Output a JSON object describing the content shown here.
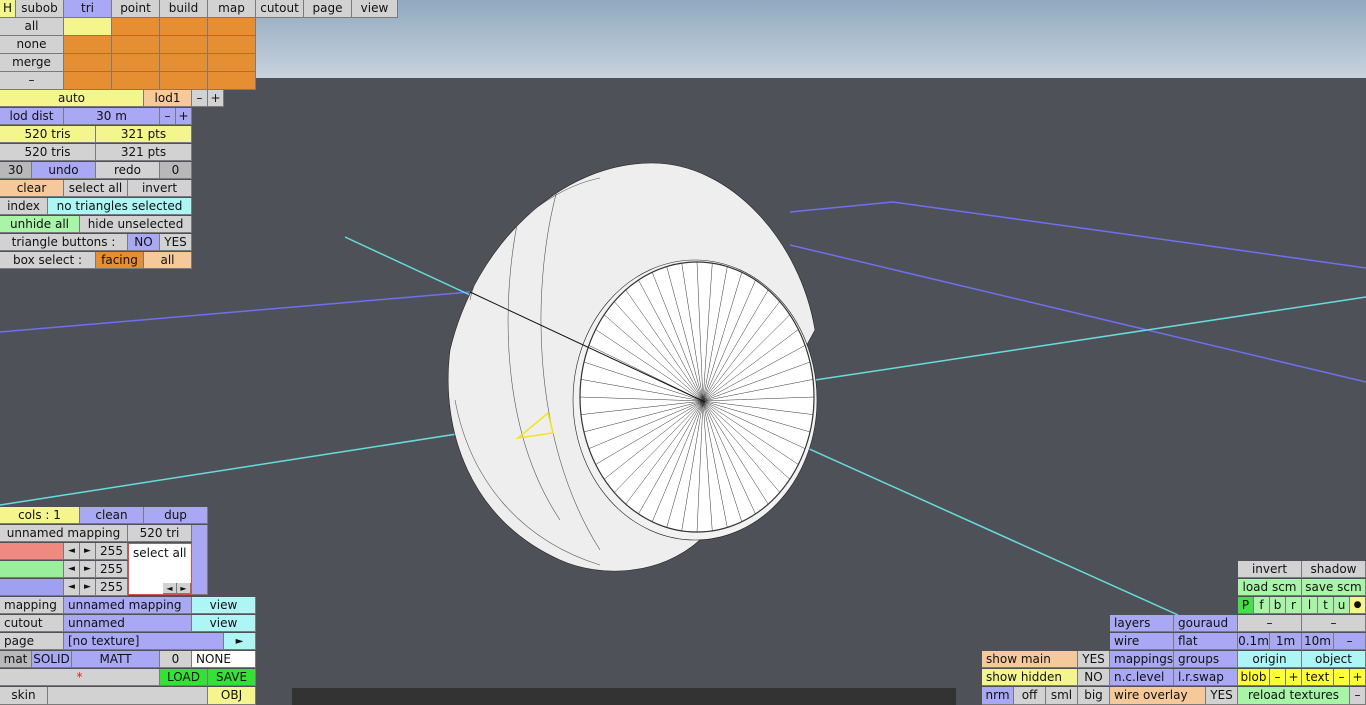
{
  "top_tabs": [
    "H",
    "subob",
    "tri",
    "point",
    "build",
    "map",
    "cutout",
    "page",
    "view"
  ],
  "sel": {
    "all": "all",
    "none": "none",
    "merge": "merge",
    "minus": "–"
  },
  "lod": {
    "auto": "auto",
    "name": "lod1",
    "minus": "–",
    "plus": "+",
    "dist_label": "lod dist",
    "dist_value": "30 m"
  },
  "counts": {
    "tris1": "520 tris",
    "pts1": "321 pts",
    "tris2": "520 tris",
    "pts2": "321 pts"
  },
  "history": {
    "n1": "30",
    "undo": "undo",
    "redo": "redo",
    "n2": "0"
  },
  "selection": {
    "clear": "clear",
    "select_all": "select all",
    "invert": "invert"
  },
  "index": {
    "label": "index",
    "status": "no triangles selected"
  },
  "hide": {
    "unhide": "unhide all",
    "hide_unsel": "hide unselected"
  },
  "tri_buttons": {
    "label": "triangle buttons :",
    "no": "NO",
    "yes": "YES"
  },
  "box_select": {
    "label": "box select :",
    "facing": "facing",
    "all": "all"
  },
  "cols": {
    "cols": "cols : 1",
    "clean": "clean",
    "dup": "dup"
  },
  "mapping_row": {
    "name": "unnamed mapping",
    "tri": "520 tri"
  },
  "channels": [
    "255",
    "255",
    "255"
  ],
  "select_all_list": "select all",
  "mapping": {
    "label": "mapping",
    "value": "unnamed mapping",
    "view": "view"
  },
  "cutout": {
    "label": "cutout",
    "value": "unnamed",
    "view": "view"
  },
  "page": {
    "label": "page",
    "value": "[no texture]",
    "arrow": "►"
  },
  "mat": {
    "label": "mat",
    "solid": "SOLID",
    "matt": "MATT",
    "num": "0",
    "none": "NONE"
  },
  "loadsave": {
    "star": "*",
    "load": "LOAD",
    "save": "SAVE"
  },
  "skin": {
    "label": "skin",
    "obj": "OBJ"
  },
  "right": {
    "invert": "invert",
    "shadow": "shadow",
    "load_scm": "load scm",
    "save_scm": "save scm",
    "letters": [
      "P",
      "f",
      "b",
      "r",
      "l",
      "t",
      "u",
      "●"
    ],
    "dash1": "–",
    "dash2": "–",
    "layers": "layers",
    "gouraud": "gouraud",
    "wire": "wire",
    "flat": "flat",
    "d01": "0.1m",
    "d1": "1m",
    "d10": "10m",
    "dminus": "–",
    "mappings": "mappings",
    "groups": "groups",
    "origin": "origin",
    "object": "object",
    "ncl": "n.c.level",
    "lrs": "l.r.swap",
    "blob": "blob",
    "bm": "–",
    "bp": "+",
    "text": "text",
    "tm": "–",
    "tp": "+",
    "wire_overlay": "wire overlay",
    "wo_yes": "YES",
    "reload": "reload textures",
    "rminus": "–"
  },
  "show": {
    "main": "show main",
    "main_yes": "YES",
    "hidden": "show hidden",
    "hidden_no": "NO",
    "nrm": "nrm",
    "off": "off",
    "sml": "sml",
    "big": "big"
  },
  "colors": {
    "sky": "#b6c7d5",
    "ground": "#4f5159",
    "grid_blue": "#6f6ff0",
    "grid_cyan": "#66dddd"
  }
}
